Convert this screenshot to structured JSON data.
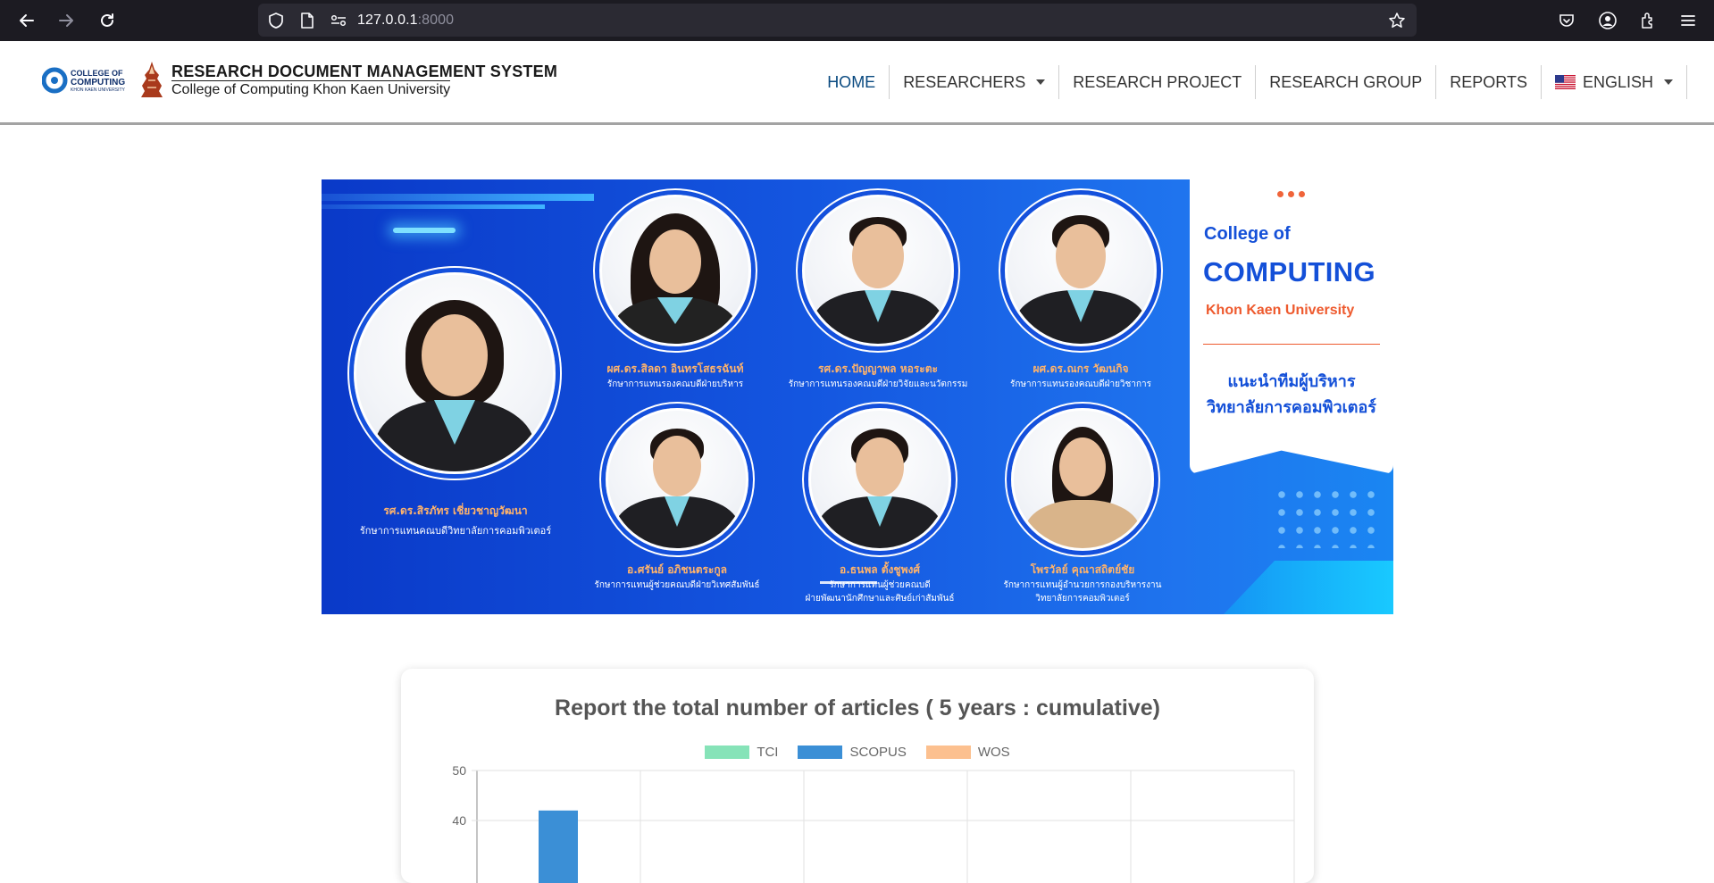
{
  "browser": {
    "url_host": "127.0.0.1",
    "url_port": ":8000"
  },
  "header": {
    "system_title": "RESEARCH DOCUMENT MANAGEMENT SYSTEM",
    "system_subtitle": "College of Computing Khon Kaen University",
    "logo_text_top": "COLLEGE OF",
    "logo_text_main": "COMPUTING",
    "logo_text_bottom": "KHON KAEN UNIVERSITY",
    "nav": {
      "home": "HOME",
      "researchers": "RESEARCHERS",
      "research_project": "RESEARCH PROJECT",
      "research_group": "RESEARCH GROUP",
      "reports": "REPORTS",
      "language": "ENGLISH"
    }
  },
  "banner": {
    "college_of": "College of",
    "computing": "COMPUTING",
    "university": "Khon Kaen University",
    "thai_line1": "แนะนำทีมผู้บริหาร",
    "thai_line2": "วิทยาลัยการคอมพิวเตอร์",
    "people": [
      {
        "name": "รศ.ดร.สิรภัทร เชี่ยวชาญวัฒนา",
        "role": "รักษาการแทนคณบดีวิทยาลัยการคอมพิวเตอร์"
      },
      {
        "name": "ผศ.ดร.สิลดา อินทรโสธรฉันท์",
        "role": "รักษาการแทนรองคณบดีฝ่ายบริหาร"
      },
      {
        "name": "รศ.ดร.ปัญญาพล หอระตะ",
        "role": "รักษาการแทนรองคณบดีฝ่ายวิจัยและนวัตกรรม"
      },
      {
        "name": "ผศ.ดร.ณกร วัฒนกิจ",
        "role": "รักษาการแทนรองคณบดีฝ่ายวิชาการ"
      },
      {
        "name": "อ.ศรันย์ อภิชนตระกูล",
        "role": "รักษาการแทนผู้ช่วยคณบดีฝ่ายวิเทศสัมพันธ์"
      },
      {
        "name": "อ.ธนพล ตั้งชูพงศ์",
        "role": "รักษาการแทนผู้ช่วยคณบดี",
        "role2": "ฝ่ายพัฒนานักศึกษาและศิษย์เก่าสัมพันธ์"
      },
      {
        "name": "โพรวัลย์ คุณาสถิตย์ชัย",
        "role": "รักษาการแทนผู้อำนวยการกองบริหารงาน",
        "role2": "วิทยาลัยการคอมพิวเตอร์"
      }
    ]
  },
  "report": {
    "title": "Report the total number of articles ( 5 years : cumulative)"
  },
  "chart_data": {
    "type": "bar",
    "title": "Report the total number of articles ( 5 years : cumulative)",
    "series": [
      {
        "name": "TCI",
        "color": "#86e3b8"
      },
      {
        "name": "SCOPUS",
        "color": "#3b8fd6",
        "values": [
          42
        ]
      },
      {
        "name": "WOS",
        "color": "#fcc08f"
      }
    ],
    "y_ticks": [
      "50",
      "40"
    ],
    "ylim": [
      0,
      50
    ],
    "grid": true,
    "legend": "top"
  }
}
